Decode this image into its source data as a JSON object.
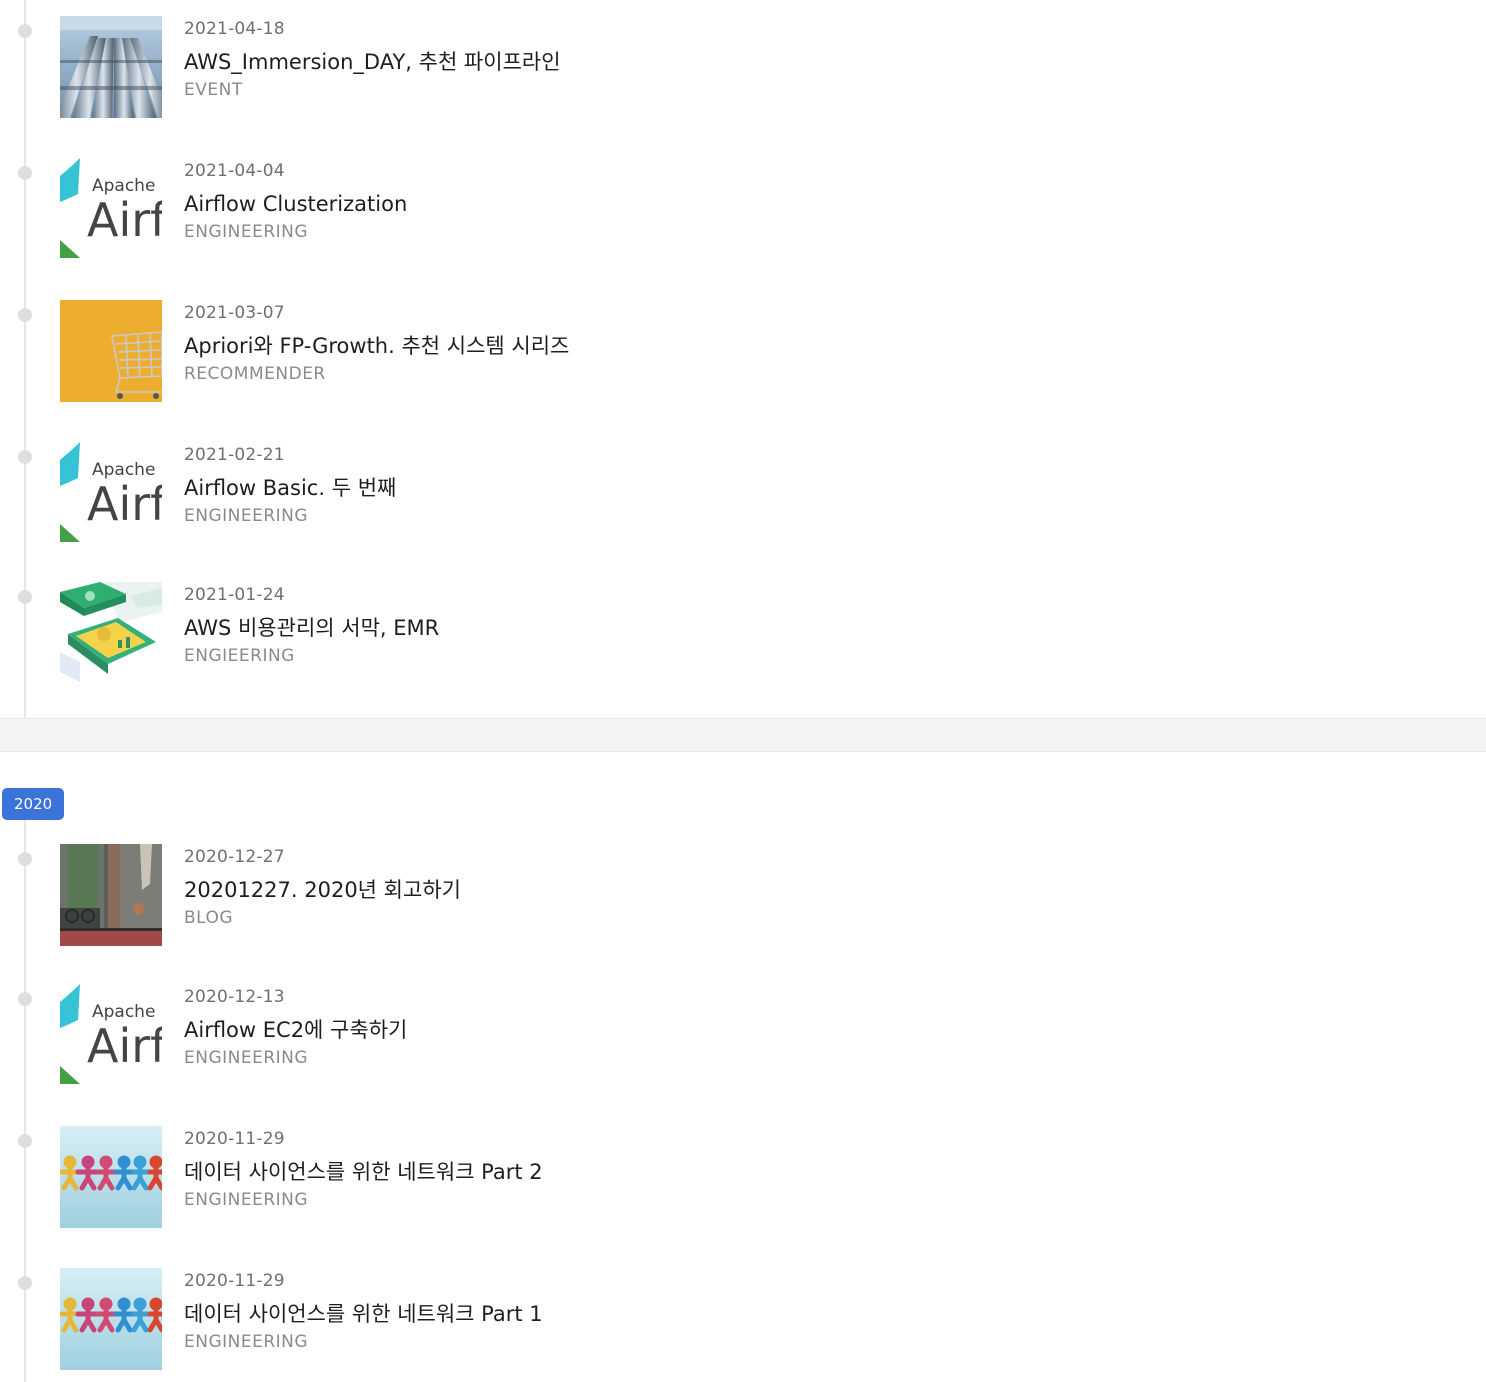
{
  "sections": [
    {
      "year": "",
      "posts": [
        {
          "date": "2021-04-18",
          "title": "AWS_Immersion_DAY, 추천 파이프라인",
          "category": "EVENT",
          "thumb": "pipes-image"
        },
        {
          "date": "2021-04-04",
          "title": "Airflow Clusterization",
          "category": "ENGINEERING",
          "thumb": "airflow-logo"
        },
        {
          "date": "2021-03-07",
          "title": "Apriori와 FP-Growth. 추천 시스템 시리즈",
          "category": "RECOMMENDER",
          "thumb": "cart-image"
        },
        {
          "date": "2021-02-21",
          "title": "Airflow Basic. 두 번째",
          "category": "ENGINEERING",
          "thumb": "airflow-logo"
        },
        {
          "date": "2021-01-24",
          "title": "AWS 비용관리의 서막, EMR",
          "category": "ENGIEERING",
          "thumb": "money-illustration"
        }
      ]
    },
    {
      "year": "2020",
      "posts": [
        {
          "date": "2020-12-27",
          "title": "20201227. 2020년 회고하기",
          "category": "BLOG",
          "thumb": "street-photo"
        },
        {
          "date": "2020-12-13",
          "title": "Airflow EC2에 구축하기",
          "category": "ENGINEERING",
          "thumb": "airflow-logo"
        },
        {
          "date": "2020-11-29",
          "title": "데이터 사이언스를 위한 네트워크 Part 2",
          "category": "ENGINEERING",
          "thumb": "paper-people-image"
        },
        {
          "date": "2020-11-29",
          "title": "데이터 사이언스를 위한 네트워크 Part 1",
          "category": "ENGINEERING",
          "thumb": "paper-people-image"
        }
      ]
    }
  ],
  "logo_text": {
    "line1": "Apache",
    "line2": "Airf"
  },
  "colors": {
    "badge": "#3c73d9",
    "timeline": "#e6e6e6",
    "dot": "#dedede"
  }
}
